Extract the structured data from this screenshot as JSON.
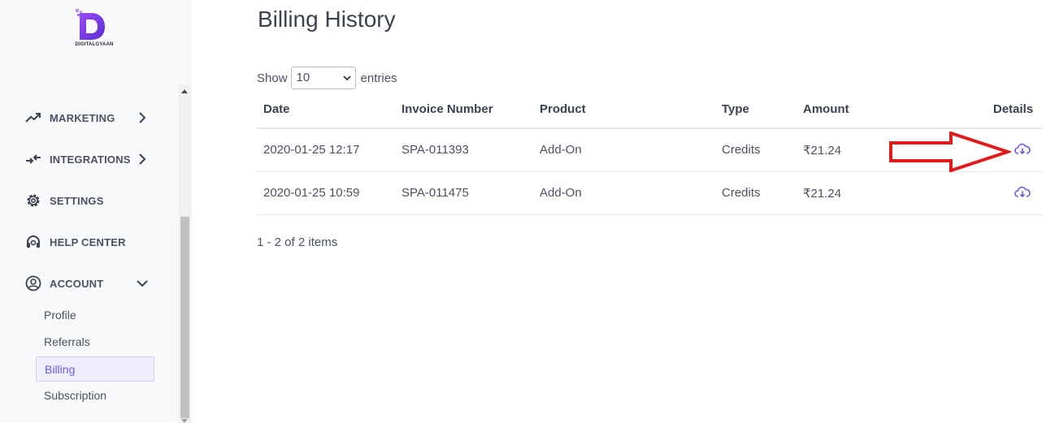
{
  "brand": {
    "name": "DigitalGyaan",
    "logo_text": "DIGITALGYAAN",
    "color": "#7b3fe4"
  },
  "sidebar": {
    "nav": [
      {
        "label": "MARKETING",
        "icon": "trending-up-icon",
        "chevron": "right"
      },
      {
        "label": "INTEGRATIONS",
        "icon": "swap-arrows-icon",
        "chevron": "right"
      },
      {
        "label": "SETTINGS",
        "icon": "gear-icon"
      },
      {
        "label": "HELP CENTER",
        "icon": "headset-icon"
      },
      {
        "label": "ACCOUNT",
        "icon": "user-circle-icon",
        "chevron": "down"
      }
    ],
    "account_sub": [
      {
        "label": "Profile"
      },
      {
        "label": "Referrals"
      },
      {
        "label": "Billing",
        "active": true
      },
      {
        "label": "Subscription"
      }
    ],
    "accent_color": "#6b5be6"
  },
  "main": {
    "title": "Billing History",
    "show_label": "Show",
    "entries_value": "10",
    "entries_label": "entries",
    "table": {
      "columns": [
        "Date",
        "Invoice Number",
        "Product",
        "Type",
        "Amount",
        "Details"
      ],
      "rows": [
        {
          "date": "2020-01-25 12:17",
          "invoice": "SPA-011393",
          "product": "Add-On",
          "type": "Credits",
          "amount": "₹21.24",
          "details_icon": "cloud-download-icon"
        },
        {
          "date": "2020-01-25 10:59",
          "invoice": "SPA-011475",
          "product": "Add-On",
          "type": "Credits",
          "amount": "₹21.24",
          "details_icon": "cloud-download-icon"
        }
      ]
    },
    "pager_text": "1 - 2 of 2 items"
  },
  "annotation": {
    "shape": "arrow-right-icon",
    "color": "#e01b1b"
  }
}
